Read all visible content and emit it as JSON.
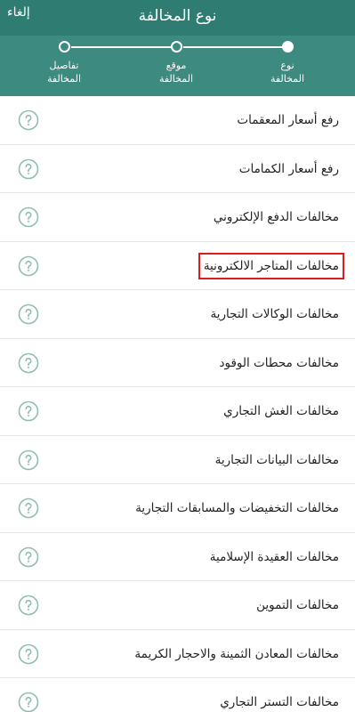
{
  "header": {
    "title": "نوع المخالفة",
    "cancel_label": "إلغاء"
  },
  "stepper": {
    "steps": [
      {
        "label": "نوع\nالمخالفة",
        "active": true
      },
      {
        "label": "موقع\nالمخالفة",
        "active": false
      },
      {
        "label": "تفاصيل\nالمخالفة",
        "active": false
      }
    ]
  },
  "violations": {
    "items": [
      {
        "label": "رفع أسعار المعقمات"
      },
      {
        "label": "رفع أسعار الكمامات"
      },
      {
        "label": "مخالفات الدفع الإلكتروني"
      },
      {
        "label": "مخالفات المتاجر الالكترونية",
        "highlighted": true
      },
      {
        "label": "مخالفات الوكالات التجارية"
      },
      {
        "label": "مخالفات محطات الوقود"
      },
      {
        "label": "مخالفات الغش التجاري"
      },
      {
        "label": "مخالفات البيانات التجارية"
      },
      {
        "label": "مخالفات التخفيضات والمسابقات التجارية"
      },
      {
        "label": "مخالفات العقيدة الإسلامية"
      },
      {
        "label": "مخالفات التموين"
      },
      {
        "label": "مخالفات المعادن الثمينة والاحجار الكريمة"
      },
      {
        "label": "مخالفات التستر التجاري"
      }
    ],
    "help_icon": "question-circle-icon"
  },
  "colors": {
    "header_bg": "#3d8a80",
    "header_bar": "#2f7d72",
    "icon": "#8fbcb3",
    "highlight_border": "#d81e1e"
  }
}
